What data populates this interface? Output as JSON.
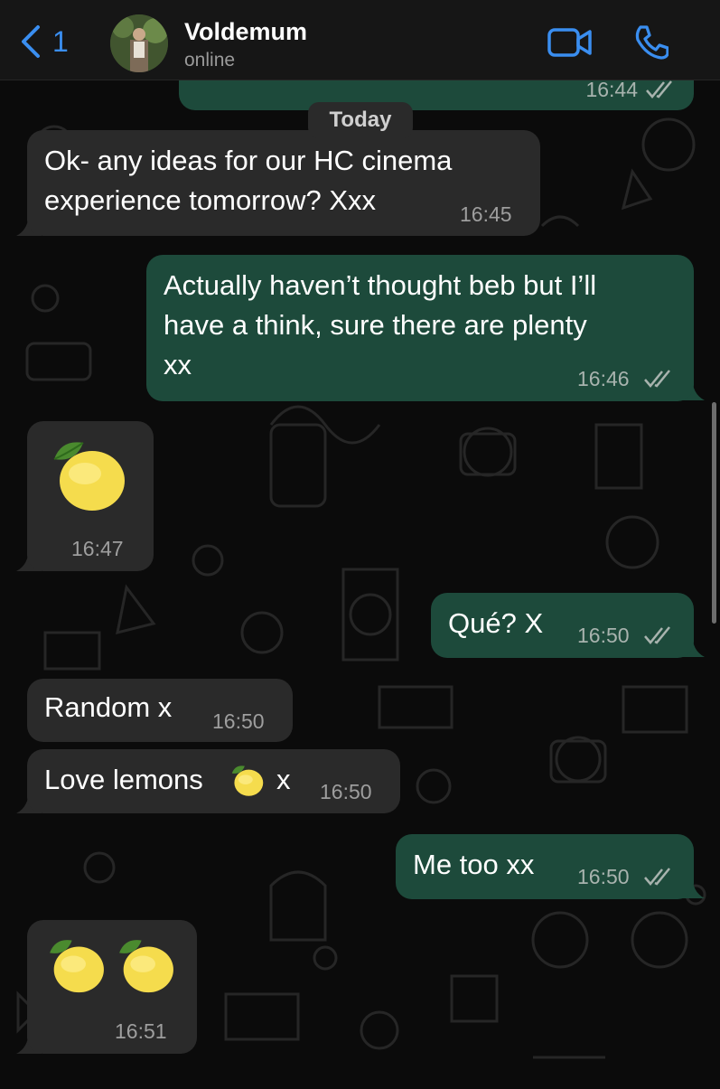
{
  "header": {
    "back_count": "1",
    "contact_name": "Voldemum",
    "status": "online"
  },
  "date_separator": "Today",
  "messages": [
    {
      "direction": "outgoing",
      "lines": [],
      "time": "16:44",
      "read": true
    },
    {
      "direction": "incoming",
      "lines": [
        "Ok- any ideas for our HC cinema",
        "experience tomorrow? Xxx"
      ],
      "time": "16:45"
    },
    {
      "direction": "outgoing",
      "lines": [
        "Actually haven’t thought beb but I’ll",
        "have a think, sure there are plenty",
        "xx"
      ],
      "time": "16:46",
      "read": true
    },
    {
      "direction": "incoming",
      "emoji": "lemon",
      "emoji_count": 1,
      "time": "16:47"
    },
    {
      "direction": "outgoing",
      "lines": [
        "Qué? X"
      ],
      "time": "16:50",
      "read": true
    },
    {
      "direction": "incoming",
      "lines": [
        "Random x"
      ],
      "time": "16:50"
    },
    {
      "direction": "incoming",
      "text_before": "Love lemons",
      "emoji": "lemon",
      "text_after": "x",
      "time": "16:50"
    },
    {
      "direction": "outgoing",
      "lines": [
        "Me too xx"
      ],
      "time": "16:50",
      "read": true
    },
    {
      "direction": "incoming",
      "emoji": "lemon",
      "emoji_count": 2,
      "time": "16:51"
    }
  ],
  "colors": {
    "accent": "#3a8ef0",
    "incoming_bubble": "#2a2a2a",
    "outgoing_bubble": "#1d4a3b",
    "read_ticks": "#a8b3ae"
  },
  "icons": [
    "back-chevron-icon",
    "video-call-icon",
    "phone-icon",
    "double-check-icon",
    "lemon-emoji"
  ]
}
